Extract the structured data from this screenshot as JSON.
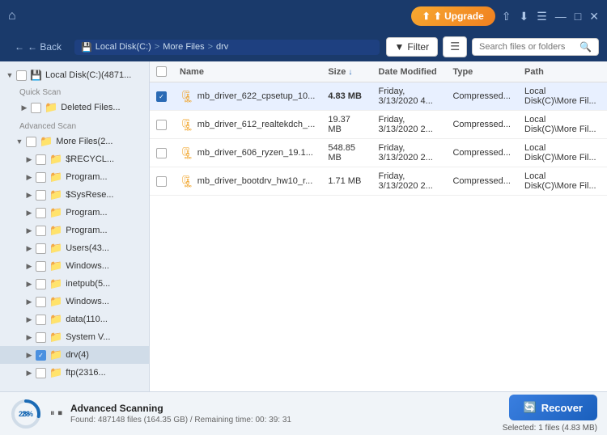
{
  "titlebar": {
    "home_icon": "⌂",
    "upgrade_label": "⬆ Upgrade",
    "share_icon": "⇧",
    "save_icon": "💾",
    "menu_icon": "☰",
    "minimize_icon": "—",
    "maximize_icon": "□",
    "close_icon": "✕"
  },
  "navbar": {
    "back_label": "← Back",
    "breadcrumb": {
      "drive": "Local Disk(C:)",
      "sep1": ">",
      "folder1": "More Files",
      "sep2": ">",
      "folder2": "drv"
    },
    "filter_label": "Filter",
    "search_placeholder": "Search files or folders"
  },
  "sidebar": {
    "quick_scan_label": "Quick Scan",
    "advanced_scan_label": "Advanced Scan",
    "root_item": "Local Disk(C:)(4871...",
    "deleted_item": "Deleted Files...",
    "more_files_item": "More Files(2...",
    "items": [
      "$RECYCL...",
      "Program...",
      "$SysRese...",
      "Program...",
      "Program...",
      "Users(43...",
      "Windows...",
      "inetpub(5...",
      "Windows...",
      "data(110...",
      "System V...",
      "drv(4)",
      "ftp(2316..."
    ]
  },
  "file_table": {
    "headers": {
      "checkbox": "",
      "name": "Name",
      "size": "Size",
      "size_sort": "↓",
      "date": "Date Modified",
      "type": "Type",
      "path": "Path"
    },
    "files": [
      {
        "selected": true,
        "name": "mb_driver_622_cpsetup_10...",
        "size": "4.83 MB",
        "date": "Friday, 3/13/2020 4...",
        "type": "Compressed...",
        "path": "Local Disk(C)\\More Fil..."
      },
      {
        "selected": false,
        "name": "mb_driver_612_realtekdch_...",
        "size": "19.37 MB",
        "date": "Friday, 3/13/2020 2...",
        "type": "Compressed...",
        "path": "Local Disk(C)\\More Fil..."
      },
      {
        "selected": false,
        "name": "mb_driver_606_ryzen_19.1...",
        "size": "548.85 MB",
        "date": "Friday, 3/13/2020 2...",
        "type": "Compressed...",
        "path": "Local Disk(C)\\More Fil..."
      },
      {
        "selected": false,
        "name": "mb_driver_bootdrv_hw10_r...",
        "size": "1.71 MB",
        "date": "Friday, 3/13/2020 2...",
        "type": "Compressed...",
        "path": "Local Disk(C)\\More Fil..."
      }
    ]
  },
  "status": {
    "progress_pct": 28,
    "title": "Advanced Scanning",
    "detail": "Found: 487148 files (164.35 GB) / Remaining time: 00: 39: 31",
    "recover_label": "Recover",
    "selected_info": "Selected: 1 files (4.83 MB)"
  }
}
